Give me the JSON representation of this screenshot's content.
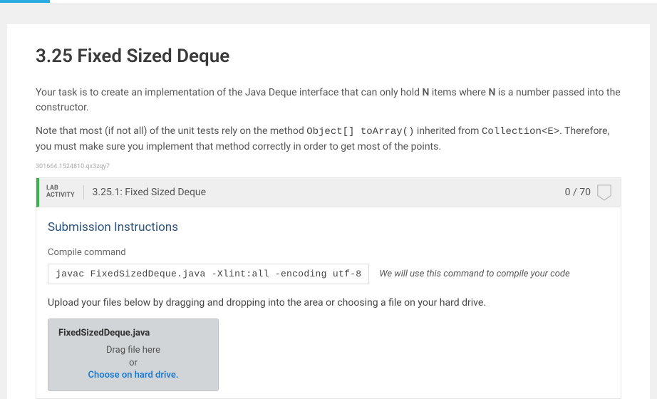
{
  "page": {
    "title": "3.25 Fixed Sized Deque",
    "para1_before_bold1": "Your task is to create an implementation of the Java Deque interface that can only hold ",
    "bold_N1": "N",
    "para1_mid": " items where ",
    "bold_N2": "N",
    "para1_after": " is a number passed into the constructor.",
    "para2_before_code1": "Note that most (if not all) of the unit tests rely on the method ",
    "code1": "Object[] toArray()",
    "para2_mid": " inherited from ",
    "code2": "Collection<E>",
    "para2_after": ". Therefore, you must make sure you implement that method correctly in order to get most of the points.",
    "tiny_id": "301664.1524810.qx3zqy7"
  },
  "lab": {
    "activity_label_line1": "LAB",
    "activity_label_line2": "ACTIVITY",
    "title": "3.25.1: Fixed Sized Deque",
    "points": "0 / 70"
  },
  "submission": {
    "heading": "Submission Instructions",
    "compile_label": "Compile command",
    "compile_command": "javac FixedSizedDeque.java -Xlint:all -encoding utf-8",
    "compile_note": "We will use this command to compile your code",
    "upload_instruction": "Upload your files below by dragging and dropping into the area or choosing a file on your hard drive."
  },
  "dropzone": {
    "filename": "FixedSizedDeque.java",
    "drag_text": "Drag file here",
    "or_text": "or",
    "choose_text": "Choose on hard drive."
  }
}
